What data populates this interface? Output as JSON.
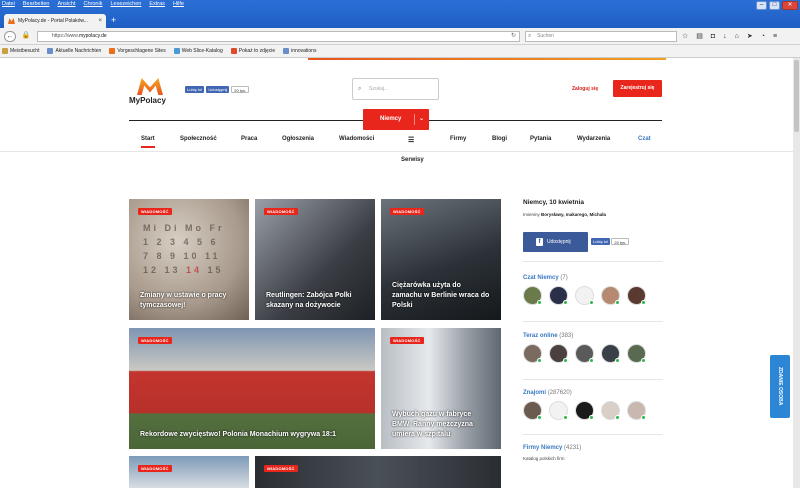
{
  "browser": {
    "menu": [
      "Datei",
      "Bearbeiten",
      "Ansicht",
      "Chronik",
      "Lesezeichen",
      "Extras",
      "Hilfe"
    ],
    "tab_title": "MyPolacy.de - Portal Polaków...",
    "url_prefix": "https://www.",
    "url_domain": "mypolacy.de",
    "search_placeholder": "Suchen",
    "bookmarks": [
      "Meistbesucht",
      "Aktuelle Nachrichten",
      "Vorgeschlagene Sites",
      "Web Slice-Katalog",
      "Pokaż to zdjęcie",
      "innovations"
    ]
  },
  "header": {
    "logo_text": "MyPolacy",
    "fb_like": "Lubię to!",
    "fb_share": "Udostępnij",
    "fb_count": "20 tys.",
    "search_placeholder": "Szukaj...",
    "login": "Zaloguj się",
    "register": "Zarejestruj się",
    "country": "Niemcy"
  },
  "nav": {
    "items": [
      "Start",
      "Społeczność",
      "Praca",
      "Ogłoszenia",
      "Wiadomości",
      "Firmy",
      "Blogi",
      "Pytania",
      "Wydarzenia",
      "Czat"
    ],
    "menu_icon": "list-icon",
    "sub": "Serwisy"
  },
  "tiles": {
    "badge": "WIADOMOŚĆ",
    "items": [
      {
        "caption": "Zmiany w ustawie o pracy tymczasowej!"
      },
      {
        "caption": "Reutlingen: Zabójca Polki skazany na dożywocie"
      },
      {
        "caption": "Ciężarówka użyta do zamachu w Berlinie wraca do Polski"
      },
      {
        "caption": "Rekordowe zwycięstwo! Polonia Monachium wygrywa 18:1"
      },
      {
        "caption": "Wybuch gazu w fabryce BMW. Ranny mężczyzna umiera w szpitalu"
      },
      {
        "caption": ""
      },
      {
        "caption": ""
      }
    ],
    "calendar_text": "Mi Di Mo Fr 1 2 3 4 5 6 7 8 9 10 11 12 13 14 15 16 17"
  },
  "sidebar": {
    "date": "Niemcy, 10 kwietnia",
    "names_label": "Imieniny",
    "names": "Borysławy, makarego, Michała",
    "share": "Udostępnij",
    "like": "Lubię to!",
    "like_count": "20 tys.",
    "chat": {
      "title": "Czat Niemcy",
      "count": "(7)"
    },
    "online": {
      "title": "Teraz online",
      "count": "(383)"
    },
    "friends": {
      "title": "Znajomi",
      "count": "(287620)"
    },
    "firms": {
      "title": "Firmy Niemcy",
      "count": "(4231)",
      "sub": "Katalog polskich firm"
    }
  },
  "feedback": "ZDANIE OSOBA",
  "colors": {
    "accent": "#e8261c",
    "link": "#3a78c3",
    "facebook": "#3b5a9a"
  }
}
